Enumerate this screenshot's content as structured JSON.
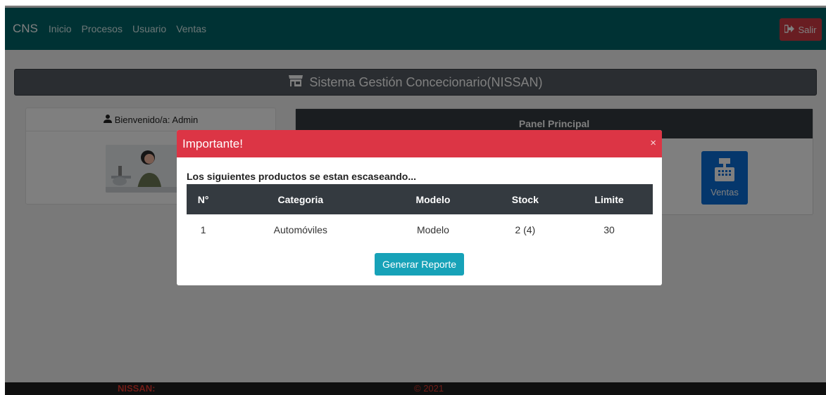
{
  "navbar": {
    "brand": "CNS",
    "links": [
      "Inicio",
      "Procesos",
      "Usuario",
      "Ventas"
    ],
    "logout_label": "Salir"
  },
  "header": {
    "title": "Sistema Gestión Concecionario(NISSAN)"
  },
  "welcome": {
    "text": "Bienvenido/a: Admin"
  },
  "panel": {
    "title": "Panel Principal",
    "ventas_label": "Ventas"
  },
  "footer": {
    "brand": "NISSAN:",
    "copyright": "© 2021"
  },
  "modal": {
    "title": "Importante!",
    "close": "×",
    "message": "Los siguientes productos se estan escaseando...",
    "columns": [
      "N°",
      "Categoria",
      "Modelo",
      "Stock",
      "Limite"
    ],
    "rows": [
      [
        "1",
        "Automóviles",
        "Modelo",
        "2 (4)",
        "30"
      ]
    ],
    "button_label": "Generar Reporte"
  },
  "colors": {
    "navbar": "#006468",
    "danger": "#dc3545",
    "info": "#17a2b8",
    "dark": "#343a40",
    "primary": "#0a6ed8"
  }
}
